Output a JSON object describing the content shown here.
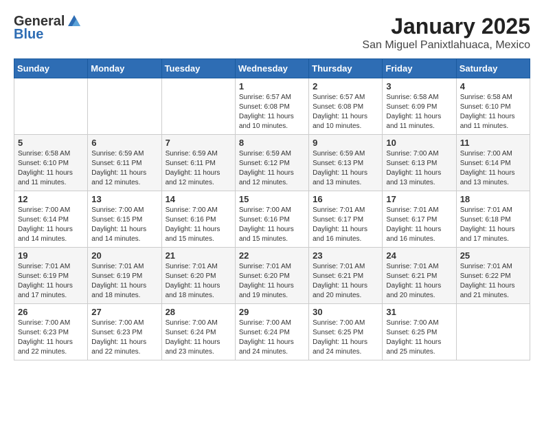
{
  "header": {
    "logo_general": "General",
    "logo_blue": "Blue",
    "title": "January 2025",
    "subtitle": "San Miguel Panixtlahuaca, Mexico"
  },
  "weekdays": [
    "Sunday",
    "Monday",
    "Tuesday",
    "Wednesday",
    "Thursday",
    "Friday",
    "Saturday"
  ],
  "weeks": [
    [
      {
        "day": "",
        "info": ""
      },
      {
        "day": "",
        "info": ""
      },
      {
        "day": "",
        "info": ""
      },
      {
        "day": "1",
        "info": "Sunrise: 6:57 AM\nSunset: 6:08 PM\nDaylight: 11 hours and 10 minutes."
      },
      {
        "day": "2",
        "info": "Sunrise: 6:57 AM\nSunset: 6:08 PM\nDaylight: 11 hours and 10 minutes."
      },
      {
        "day": "3",
        "info": "Sunrise: 6:58 AM\nSunset: 6:09 PM\nDaylight: 11 hours and 11 minutes."
      },
      {
        "day": "4",
        "info": "Sunrise: 6:58 AM\nSunset: 6:10 PM\nDaylight: 11 hours and 11 minutes."
      }
    ],
    [
      {
        "day": "5",
        "info": "Sunrise: 6:58 AM\nSunset: 6:10 PM\nDaylight: 11 hours and 11 minutes."
      },
      {
        "day": "6",
        "info": "Sunrise: 6:59 AM\nSunset: 6:11 PM\nDaylight: 11 hours and 12 minutes."
      },
      {
        "day": "7",
        "info": "Sunrise: 6:59 AM\nSunset: 6:11 PM\nDaylight: 11 hours and 12 minutes."
      },
      {
        "day": "8",
        "info": "Sunrise: 6:59 AM\nSunset: 6:12 PM\nDaylight: 11 hours and 12 minutes."
      },
      {
        "day": "9",
        "info": "Sunrise: 6:59 AM\nSunset: 6:13 PM\nDaylight: 11 hours and 13 minutes."
      },
      {
        "day": "10",
        "info": "Sunrise: 7:00 AM\nSunset: 6:13 PM\nDaylight: 11 hours and 13 minutes."
      },
      {
        "day": "11",
        "info": "Sunrise: 7:00 AM\nSunset: 6:14 PM\nDaylight: 11 hours and 13 minutes."
      }
    ],
    [
      {
        "day": "12",
        "info": "Sunrise: 7:00 AM\nSunset: 6:14 PM\nDaylight: 11 hours and 14 minutes."
      },
      {
        "day": "13",
        "info": "Sunrise: 7:00 AM\nSunset: 6:15 PM\nDaylight: 11 hours and 14 minutes."
      },
      {
        "day": "14",
        "info": "Sunrise: 7:00 AM\nSunset: 6:16 PM\nDaylight: 11 hours and 15 minutes."
      },
      {
        "day": "15",
        "info": "Sunrise: 7:00 AM\nSunset: 6:16 PM\nDaylight: 11 hours and 15 minutes."
      },
      {
        "day": "16",
        "info": "Sunrise: 7:01 AM\nSunset: 6:17 PM\nDaylight: 11 hours and 16 minutes."
      },
      {
        "day": "17",
        "info": "Sunrise: 7:01 AM\nSunset: 6:17 PM\nDaylight: 11 hours and 16 minutes."
      },
      {
        "day": "18",
        "info": "Sunrise: 7:01 AM\nSunset: 6:18 PM\nDaylight: 11 hours and 17 minutes."
      }
    ],
    [
      {
        "day": "19",
        "info": "Sunrise: 7:01 AM\nSunset: 6:19 PM\nDaylight: 11 hours and 17 minutes."
      },
      {
        "day": "20",
        "info": "Sunrise: 7:01 AM\nSunset: 6:19 PM\nDaylight: 11 hours and 18 minutes."
      },
      {
        "day": "21",
        "info": "Sunrise: 7:01 AM\nSunset: 6:20 PM\nDaylight: 11 hours and 18 minutes."
      },
      {
        "day": "22",
        "info": "Sunrise: 7:01 AM\nSunset: 6:20 PM\nDaylight: 11 hours and 19 minutes."
      },
      {
        "day": "23",
        "info": "Sunrise: 7:01 AM\nSunset: 6:21 PM\nDaylight: 11 hours and 20 minutes."
      },
      {
        "day": "24",
        "info": "Sunrise: 7:01 AM\nSunset: 6:21 PM\nDaylight: 11 hours and 20 minutes."
      },
      {
        "day": "25",
        "info": "Sunrise: 7:01 AM\nSunset: 6:22 PM\nDaylight: 11 hours and 21 minutes."
      }
    ],
    [
      {
        "day": "26",
        "info": "Sunrise: 7:00 AM\nSunset: 6:23 PM\nDaylight: 11 hours and 22 minutes."
      },
      {
        "day": "27",
        "info": "Sunrise: 7:00 AM\nSunset: 6:23 PM\nDaylight: 11 hours and 22 minutes."
      },
      {
        "day": "28",
        "info": "Sunrise: 7:00 AM\nSunset: 6:24 PM\nDaylight: 11 hours and 23 minutes."
      },
      {
        "day": "29",
        "info": "Sunrise: 7:00 AM\nSunset: 6:24 PM\nDaylight: 11 hours and 24 minutes."
      },
      {
        "day": "30",
        "info": "Sunrise: 7:00 AM\nSunset: 6:25 PM\nDaylight: 11 hours and 24 minutes."
      },
      {
        "day": "31",
        "info": "Sunrise: 7:00 AM\nSunset: 6:25 PM\nDaylight: 11 hours and 25 minutes."
      },
      {
        "day": "",
        "info": ""
      }
    ]
  ]
}
